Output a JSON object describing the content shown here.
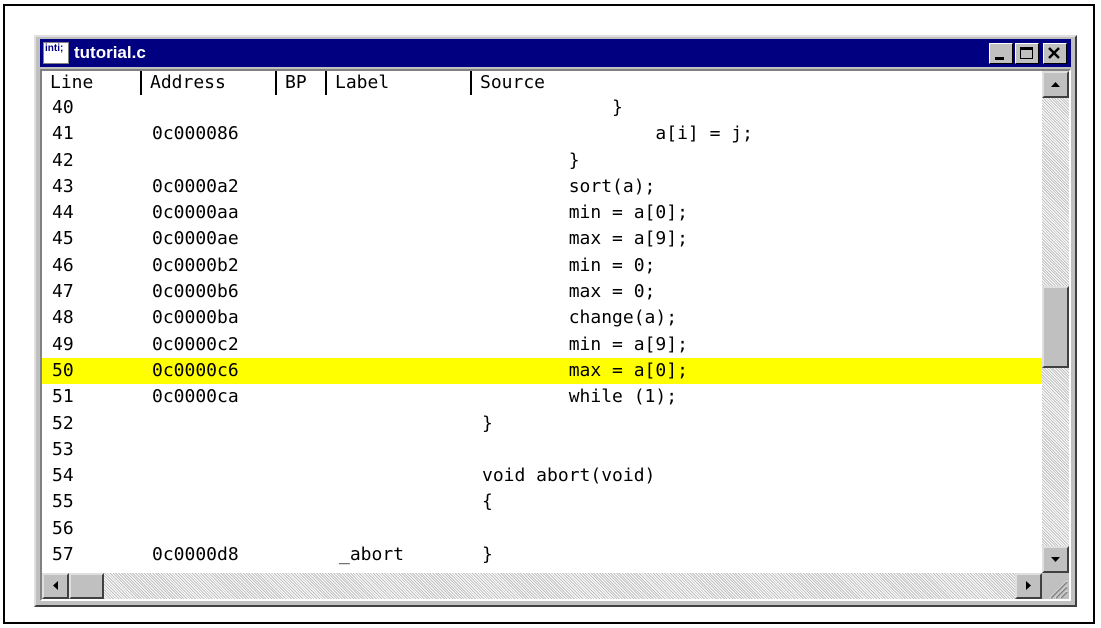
{
  "window": {
    "title": "tutorial.c",
    "icon_text": "inti;",
    "icon": "app-icon",
    "buttons": [
      "minimize-icon",
      "maximize-icon",
      "close-icon"
    ]
  },
  "columns": {
    "line": "Line",
    "address": "Address",
    "bp": "BP",
    "label": "Label",
    "source": "Source"
  },
  "rows": [
    {
      "line": "40",
      "address": "",
      "label": "",
      "source": "            }"
    },
    {
      "line": "41",
      "address": "0c000086",
      "label": "",
      "source": "                a[i] = j;"
    },
    {
      "line": "42",
      "address": "",
      "label": "",
      "source": "        }"
    },
    {
      "line": "43",
      "address": "0c0000a2",
      "label": "",
      "source": "        sort(a);"
    },
    {
      "line": "44",
      "address": "0c0000aa",
      "label": "",
      "source": "        min = a[0];"
    },
    {
      "line": "45",
      "address": "0c0000ae",
      "label": "",
      "source": "        max = a[9];"
    },
    {
      "line": "46",
      "address": "0c0000b2",
      "label": "",
      "source": "        min = 0;"
    },
    {
      "line": "47",
      "address": "0c0000b6",
      "label": "",
      "source": "        max = 0;"
    },
    {
      "line": "48",
      "address": "0c0000ba",
      "label": "",
      "source": "        change(a);"
    },
    {
      "line": "49",
      "address": "0c0000c2",
      "label": "",
      "source": "        min = a[9];"
    },
    {
      "line": "50",
      "address": "0c0000c6",
      "label": "",
      "source": "        max = a[0];"
    },
    {
      "line": "51",
      "address": "0c0000ca",
      "label": "",
      "source": "        while (1);"
    },
    {
      "line": "52",
      "address": "",
      "label": "",
      "source": "}"
    },
    {
      "line": "53",
      "address": "",
      "label": "",
      "source": ""
    },
    {
      "line": "54",
      "address": "",
      "label": "",
      "source": "void abort(void)"
    },
    {
      "line": "55",
      "address": "",
      "label": "",
      "source": "{"
    },
    {
      "line": "56",
      "address": "",
      "label": "",
      "source": ""
    },
    {
      "line": "57",
      "address": "0c0000d8",
      "label": "_abort",
      "source": "}"
    }
  ],
  "current_line": "50",
  "colors": {
    "titlebar": "#000080",
    "current_line_highlight": "#ffff00",
    "window_face": "#c0c0c0"
  },
  "scroll": {
    "vertical_position_fraction": 0.55,
    "horizontal_position_fraction": 0.0
  }
}
